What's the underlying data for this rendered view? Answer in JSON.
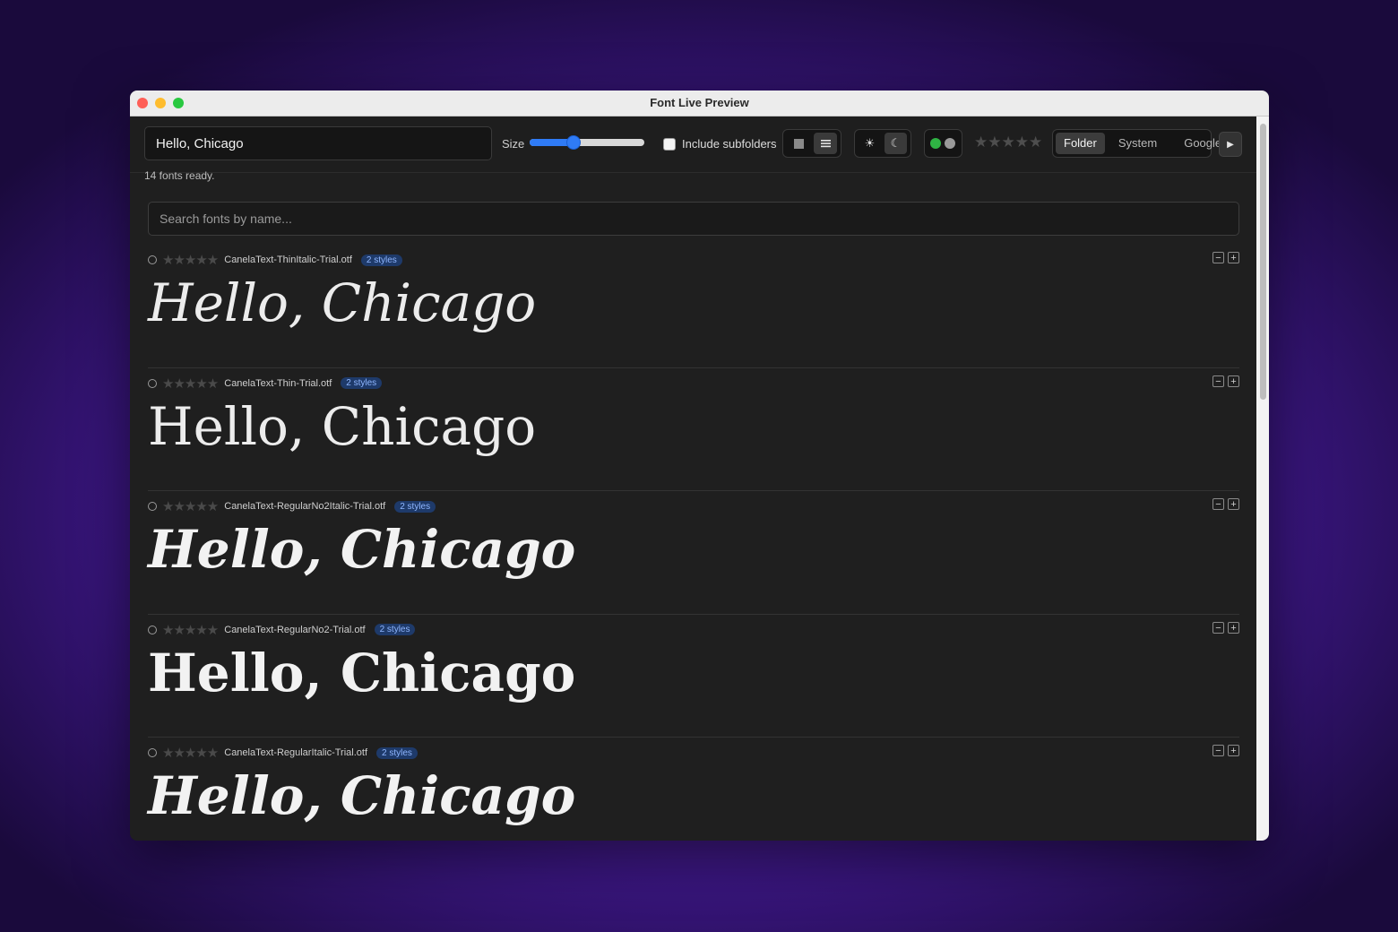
{
  "window": {
    "title": "Font Live Preview"
  },
  "toolbar": {
    "preview_text": "Hello, Chicago",
    "size_label": "Size",
    "size_value_fraction": 0.38,
    "include_subfolders_label": "Include subfolders",
    "include_subfolders_checked": false,
    "view_modes": [
      "grid-icon",
      "list-icon"
    ],
    "view_active": "list",
    "theme_modes": [
      "sun-icon",
      "moon-icon"
    ],
    "theme_active": "dark",
    "color_dots": [
      "#2fb344",
      "#9a9a9a"
    ],
    "rating_filter_stars": 5,
    "sources": [
      {
        "label": "Folder",
        "active": true
      },
      {
        "label": "System",
        "active": false
      },
      {
        "label": "Google",
        "active": false
      }
    ],
    "more_icon": "chevron-right-icon"
  },
  "status": "14 fonts ready.",
  "search": {
    "placeholder": "Search fonts by name..."
  },
  "fonts": [
    {
      "file": "CanelaText-ThinItalic-Trial.otf",
      "styles": "2 styles",
      "sample": "Hello, Chicago",
      "rating": 0
    },
    {
      "file": "CanelaText-Thin-Trial.otf",
      "styles": "2 styles",
      "sample": "Hello, Chicago",
      "rating": 0
    },
    {
      "file": "CanelaText-RegularNo2Italic-Trial.otf",
      "styles": "2 styles",
      "sample": "Hello, Chicago",
      "rating": 0
    },
    {
      "file": "CanelaText-RegularNo2-Trial.otf",
      "styles": "2 styles",
      "sample": "Hello, Chicago",
      "rating": 0
    },
    {
      "file": "CanelaText-RegularItalic-Trial.otf",
      "styles": "2 styles",
      "sample": "Hello, Chicago",
      "rating": 0
    }
  ],
  "row_controls": {
    "minus": "−",
    "plus": "+"
  },
  "colors": {
    "accent": "#2f7bf6",
    "badge_bg": "#1e3a6a",
    "badge_text": "#8fb6ff"
  }
}
